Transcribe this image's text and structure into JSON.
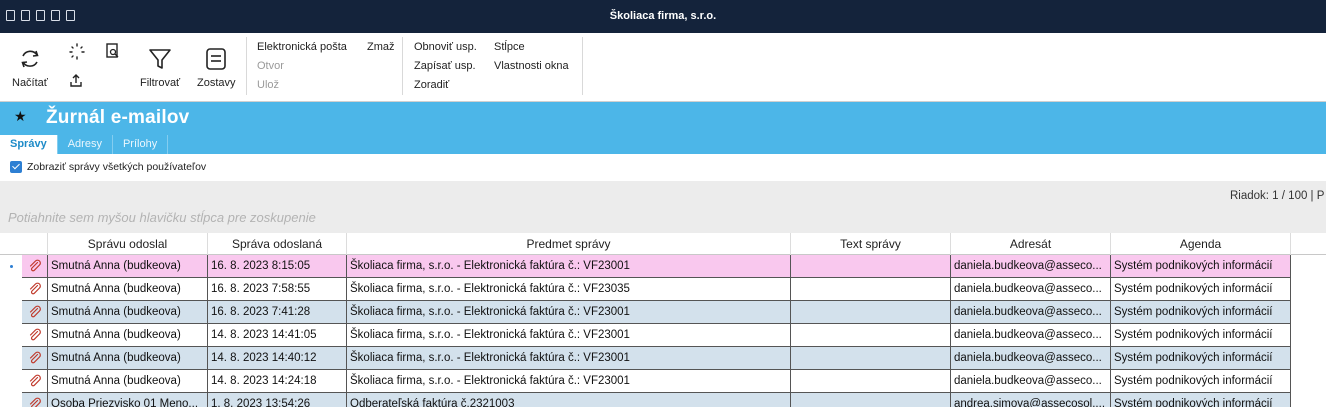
{
  "window": {
    "title": "Školiaca firma, s.r.o."
  },
  "ribbon": {
    "load_label": "Načítať",
    "filter_label": "Filtrovať",
    "reports_label": "Zostavy",
    "email_label": "Elektronická pošta",
    "delete_label": "Zmaž",
    "open_label": "Otvor",
    "save_label": "Ulož",
    "restore_label": "Obnoviť usp.",
    "write_label": "Zapísať usp.",
    "sort_label": "Zoradiť",
    "columns_label": "Stĺpce",
    "window_props_label": "Vlastnosti okna"
  },
  "page": {
    "title": "Žurnál e-mailov"
  },
  "tabs": [
    {
      "label": "Správy",
      "active": true
    },
    {
      "label": "Adresy",
      "active": false
    },
    {
      "label": "Prílohy",
      "active": false
    }
  ],
  "options": {
    "show_all_users_label": "Zobraziť správy všetkých používateľov",
    "show_all_users_checked": true
  },
  "status": {
    "row_info": "Riadok: 1 / 100 | P"
  },
  "group_hint": "Potiahnite sem myšou hlavičku stĺpca pre zoskupenie",
  "grid": {
    "columns": [
      "Správu odoslal",
      "Správa odoslaná",
      "Predmet správy",
      "Text správy",
      "Adresát",
      "Agenda"
    ],
    "rows": [
      {
        "sender": "Smutná Anna  (budkeova)",
        "sent": "16. 8. 2023 8:15:05",
        "subject": "Školiaca firma, s.r.o. - Elektronická faktúra č.: VF23001",
        "text": "",
        "recipient": "daniela.budkeova@asseco...",
        "agenda": "Systém podnikových informácií"
      },
      {
        "sender": "Smutná Anna  (budkeova)",
        "sent": "16. 8. 2023 7:58:55",
        "subject": "Školiaca firma, s.r.o. - Elektronická faktúra č.: VF23035",
        "text": "",
        "recipient": "daniela.budkeova@asseco...",
        "agenda": "Systém podnikových informácií"
      },
      {
        "sender": "Smutná Anna  (budkeova)",
        "sent": "16. 8. 2023 7:41:28",
        "subject": "Školiaca firma, s.r.o. - Elektronická faktúra č.: VF23001",
        "text": "",
        "recipient": "daniela.budkeova@asseco...",
        "agenda": "Systém podnikových informácií"
      },
      {
        "sender": "Smutná Anna  (budkeova)",
        "sent": "14. 8. 2023 14:41:05",
        "subject": "Školiaca firma, s.r.o. - Elektronická faktúra č.: VF23001",
        "text": "",
        "recipient": "daniela.budkeova@asseco...",
        "agenda": "Systém podnikových informácií"
      },
      {
        "sender": "Smutná Anna  (budkeova)",
        "sent": "14. 8. 2023 14:40:12",
        "subject": "Školiaca firma, s.r.o. - Elektronická faktúra č.: VF23001",
        "text": "",
        "recipient": "daniela.budkeova@asseco...",
        "agenda": "Systém podnikových informácií"
      },
      {
        "sender": "Smutná Anna  (budkeova)",
        "sent": "14. 8. 2023 14:24:18",
        "subject": "Školiaca firma, s.r.o. - Elektronická faktúra č.: VF23001",
        "text": "",
        "recipient": "daniela.budkeova@asseco...",
        "agenda": "Systém podnikových informácií"
      },
      {
        "sender": "Osoba Priezvisko 01 Meno...",
        "sent": "1. 8. 2023 13:54:26",
        "subject": "Odberateľská faktúra č.2321003",
        "text": "",
        "recipient": "andrea.simova@assecosol....",
        "agenda": "Systém podnikových informácií"
      }
    ]
  },
  "icons": {
    "refresh": "refresh-icon",
    "spinner": "loading-icon",
    "preview": "preview-icon",
    "export": "export-icon",
    "filter": "filter-icon",
    "reports": "reports-icon",
    "attachment": "attachment-icon",
    "star": "star-icon"
  },
  "colors": {
    "titlebar": "#14233b",
    "header": "#4cb6e8",
    "selected_row": "#f9c8ee",
    "alt_row": "#d3e1ec",
    "checkbox": "#2d7fd3",
    "attachment_icon": "#c0392b"
  }
}
